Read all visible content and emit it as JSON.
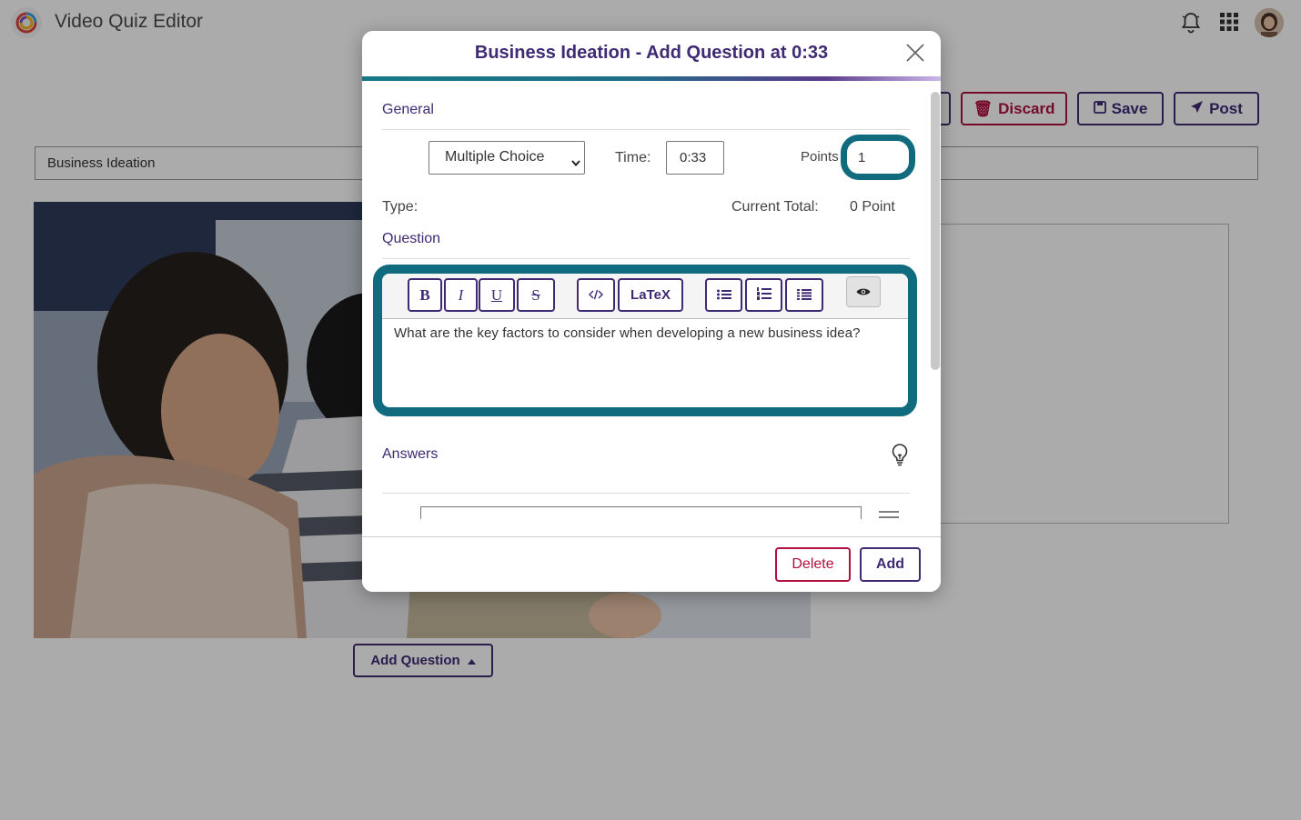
{
  "app": {
    "title": "Video Quiz Editor"
  },
  "header_actions": {
    "discard": "Discard",
    "save": "Save",
    "post": "Post"
  },
  "quiz": {
    "title_value": "Business Ideation"
  },
  "video": {
    "add_question_label": "Add Question"
  },
  "modal": {
    "title": "Business Ideation - Add Question at 0:33",
    "general": {
      "section": "General",
      "type_label": "Type:",
      "type_value": "Multiple Choice",
      "time_label": "Time:",
      "time_value": "0:33",
      "points_label": "Points",
      "points_value": "1",
      "total_label": "Current Total:",
      "total_value": "0 Point"
    },
    "question": {
      "section": "Question",
      "toolbar": {
        "bold": "B",
        "italic": "I",
        "underline": "U",
        "strike": "S",
        "latex": "LaTeX"
      },
      "text": "What are the key factors to consider when developing a new business idea?"
    },
    "answers": {
      "section": "Answers"
    },
    "footer": {
      "delete": "Delete",
      "add": "Add"
    }
  },
  "colors": {
    "brand": "#3f2a73",
    "accent": "#0f6b7d",
    "danger": "#b01040"
  }
}
